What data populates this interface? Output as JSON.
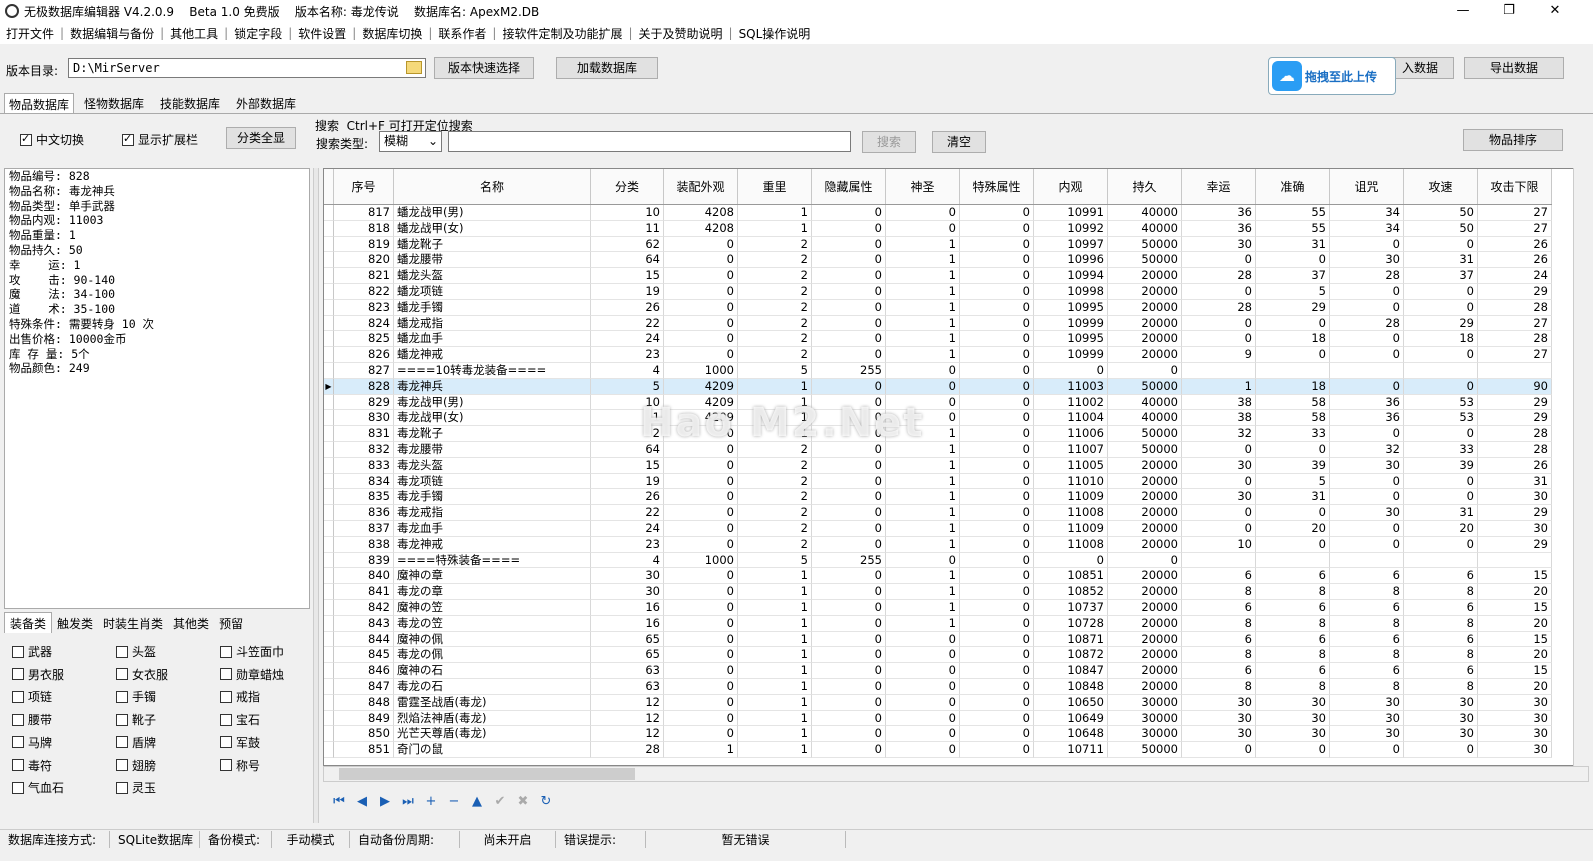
{
  "window": {
    "title": "无极数据库编辑器 V4.2.0.9    Beta 1.0 免费版    版本名称: 毒龙传说    数据库名: ApexM2.DB",
    "min": "—",
    "max": "❐",
    "close": "✕"
  },
  "menu": [
    "打开文件",
    "数据编辑与备份",
    "其他工具",
    "锁定字段",
    "软件设置",
    "数据库切换",
    "联系作者",
    "接软件定制及功能扩展",
    "关于及赞助说明",
    "SQL操作说明"
  ],
  "toolbar": {
    "dir_label": "版本目录:",
    "dir_value": "D:\\MirServer",
    "quick_select": "版本快速选择",
    "load_db": "加载数据库",
    "import_data": "入数据",
    "export_data": "导出数据",
    "upload_label": "拖拽至此上传"
  },
  "tabs": [
    "物品数据库",
    "怪物数据库",
    "技能数据库",
    "外部数据库"
  ],
  "options": {
    "cn_switch": "中文切换",
    "show_ext": "显示扩展栏",
    "show_all": "分类全显",
    "search_title": "搜索  Ctrl+F 可打开定位搜索",
    "search_type_label": "搜索类型:",
    "search_type_value": "模糊",
    "search_btn": "搜索",
    "clear_btn": "清空",
    "sort_btn": "物品排序"
  },
  "info": [
    "物品编号: 828",
    "物品名称: 毒龙神兵",
    "物品类型: 单手武器",
    "物品内观: 11003",
    "物品重量: 1",
    "物品持久: 50",
    "幸    运: 1",
    "攻    击: 90-140",
    "魔    法: 34-100",
    "道    术: 35-100",
    "特殊条件: 需要转身 10 次",
    "出售价格: 10000金币",
    "库 存 量: 5个",
    "物品颜色: 249"
  ],
  "grid": {
    "columns": [
      "序号",
      "名称",
      "分类",
      "装配外观",
      "重里",
      "隐藏属性",
      "神圣",
      "特殊属性",
      "内观",
      "持久",
      "幸运",
      "准确",
      "诅咒",
      "攻速",
      "攻击下限"
    ],
    "rows": [
      [
        "817",
        "蟠龙战甲(男)",
        "10",
        "4208",
        "1",
        "0",
        "0",
        "0",
        "10991",
        "40000",
        "36",
        "55",
        "34",
        "50",
        "27"
      ],
      [
        "818",
        "蟠龙战甲(女)",
        "11",
        "4208",
        "1",
        "0",
        "0",
        "0",
        "10992",
        "40000",
        "36",
        "55",
        "34",
        "50",
        "27"
      ],
      [
        "819",
        "蟠龙靴子",
        "62",
        "0",
        "2",
        "0",
        "1",
        "0",
        "10997",
        "50000",
        "30",
        "31",
        "0",
        "0",
        "26"
      ],
      [
        "820",
        "蟠龙腰带",
        "64",
        "0",
        "2",
        "0",
        "1",
        "0",
        "10996",
        "50000",
        "0",
        "0",
        "30",
        "31",
        "26"
      ],
      [
        "821",
        "蟠龙头盔",
        "15",
        "0",
        "2",
        "0",
        "1",
        "0",
        "10994",
        "20000",
        "28",
        "37",
        "28",
        "37",
        "24"
      ],
      [
        "822",
        "蟠龙项链",
        "19",
        "0",
        "2",
        "0",
        "1",
        "0",
        "10998",
        "20000",
        "0",
        "5",
        "0",
        "0",
        "29"
      ],
      [
        "823",
        "蟠龙手镯",
        "26",
        "0",
        "2",
        "0",
        "1",
        "0",
        "10995",
        "20000",
        "28",
        "29",
        "0",
        "0",
        "28"
      ],
      [
        "824",
        "蟠龙戒指",
        "22",
        "0",
        "2",
        "0",
        "1",
        "0",
        "10999",
        "20000",
        "0",
        "0",
        "28",
        "29",
        "27"
      ],
      [
        "825",
        "蟠龙血手",
        "24",
        "0",
        "2",
        "0",
        "1",
        "0",
        "10995",
        "20000",
        "0",
        "18",
        "0",
        "18",
        "28"
      ],
      [
        "826",
        "蟠龙神戒",
        "23",
        "0",
        "2",
        "0",
        "1",
        "0",
        "10999",
        "20000",
        "9",
        "0",
        "0",
        "0",
        "27"
      ],
      [
        "827",
        "====10转毒龙装备====",
        "4",
        "1000",
        "5",
        "255",
        "0",
        "0",
        "0",
        "0",
        "",
        "",
        "",
        "",
        ""
      ],
      [
        "828",
        "毒龙神兵",
        "5",
        "4209",
        "1",
        "0",
        "0",
        "0",
        "11003",
        "50000",
        "1",
        "18",
        "0",
        "0",
        "90"
      ],
      [
        "829",
        "毒龙战甲(男)",
        "10",
        "4209",
        "1",
        "0",
        "0",
        "0",
        "11002",
        "40000",
        "38",
        "58",
        "36",
        "53",
        "29"
      ],
      [
        "830",
        "毒龙战甲(女)",
        "1",
        "4209",
        "1",
        "0",
        "0",
        "0",
        "11004",
        "40000",
        "38",
        "58",
        "36",
        "53",
        "29"
      ],
      [
        "831",
        "毒龙靴子",
        "2",
        "0",
        "1",
        "0",
        "1",
        "0",
        "11006",
        "50000",
        "32",
        "33",
        "0",
        "0",
        "28"
      ],
      [
        "832",
        "毒龙腰带",
        "64",
        "0",
        "2",
        "0",
        "1",
        "0",
        "11007",
        "50000",
        "0",
        "0",
        "32",
        "33",
        "28"
      ],
      [
        "833",
        "毒龙头盔",
        "15",
        "0",
        "2",
        "0",
        "1",
        "0",
        "11005",
        "20000",
        "30",
        "39",
        "30",
        "39",
        "26"
      ],
      [
        "834",
        "毒龙项链",
        "19",
        "0",
        "2",
        "0",
        "1",
        "0",
        "11010",
        "20000",
        "0",
        "5",
        "0",
        "0",
        "31"
      ],
      [
        "835",
        "毒龙手镯",
        "26",
        "0",
        "2",
        "0",
        "1",
        "0",
        "11009",
        "20000",
        "30",
        "31",
        "0",
        "0",
        "30"
      ],
      [
        "836",
        "毒龙戒指",
        "22",
        "0",
        "2",
        "0",
        "1",
        "0",
        "11008",
        "20000",
        "0",
        "0",
        "30",
        "31",
        "29"
      ],
      [
        "837",
        "毒龙血手",
        "24",
        "0",
        "2",
        "0",
        "1",
        "0",
        "11009",
        "20000",
        "0",
        "20",
        "0",
        "20",
        "30"
      ],
      [
        "838",
        "毒龙神戒",
        "23",
        "0",
        "2",
        "0",
        "1",
        "0",
        "11008",
        "20000",
        "10",
        "0",
        "0",
        "0",
        "29"
      ],
      [
        "839",
        "====特殊装备====",
        "4",
        "1000",
        "5",
        "255",
        "0",
        "0",
        "0",
        "0",
        "",
        "",
        "",
        "",
        ""
      ],
      [
        "840",
        "魔神の章",
        "30",
        "0",
        "1",
        "0",
        "1",
        "0",
        "10851",
        "20000",
        "6",
        "6",
        "6",
        "6",
        "15"
      ],
      [
        "841",
        "毒龙の章",
        "30",
        "0",
        "1",
        "0",
        "1",
        "0",
        "10852",
        "20000",
        "8",
        "8",
        "8",
        "8",
        "20"
      ],
      [
        "842",
        "魔神の笠",
        "16",
        "0",
        "1",
        "0",
        "1",
        "0",
        "10737",
        "20000",
        "6",
        "6",
        "6",
        "6",
        "15"
      ],
      [
        "843",
        "毒龙の笠",
        "16",
        "0",
        "1",
        "0",
        "1",
        "0",
        "10728",
        "20000",
        "8",
        "8",
        "8",
        "8",
        "20"
      ],
      [
        "844",
        "魔神の佩",
        "65",
        "0",
        "1",
        "0",
        "0",
        "0",
        "10871",
        "20000",
        "6",
        "6",
        "6",
        "6",
        "15"
      ],
      [
        "845",
        "毒龙の佩",
        "65",
        "0",
        "1",
        "0",
        "0",
        "0",
        "10872",
        "20000",
        "8",
        "8",
        "8",
        "8",
        "20"
      ],
      [
        "846",
        "魔神の石",
        "63",
        "0",
        "1",
        "0",
        "0",
        "0",
        "10847",
        "20000",
        "6",
        "6",
        "6",
        "6",
        "15"
      ],
      [
        "847",
        "毒龙の石",
        "63",
        "0",
        "1",
        "0",
        "0",
        "0",
        "10848",
        "20000",
        "8",
        "8",
        "8",
        "8",
        "20"
      ],
      [
        "848",
        "雷霆圣战盾(毒龙)",
        "12",
        "0",
        "1",
        "0",
        "0",
        "0",
        "10650",
        "30000",
        "30",
        "30",
        "30",
        "30",
        "30"
      ],
      [
        "849",
        "烈焰法神盾(毒龙)",
        "12",
        "0",
        "1",
        "0",
        "0",
        "0",
        "10649",
        "30000",
        "30",
        "30",
        "30",
        "30",
        "30"
      ],
      [
        "850",
        "光芒天尊盾(毒龙)",
        "12",
        "0",
        "1",
        "0",
        "0",
        "0",
        "10648",
        "30000",
        "30",
        "30",
        "30",
        "30",
        "30"
      ],
      [
        "851",
        "奇门の鼠",
        "28",
        "1",
        "1",
        "0",
        "0",
        "0",
        "10711",
        "50000",
        "0",
        "0",
        "0",
        "0",
        "30"
      ]
    ],
    "selected_row": "828"
  },
  "categories": {
    "tabs": [
      "装备类",
      "触发类",
      "时装生肖类",
      "其他类",
      "预留"
    ],
    "items": [
      "武器",
      "头盔",
      "斗笠面巾",
      "男衣服",
      "女衣服",
      "勋章蜡烛",
      "项链",
      "手镯",
      "戒指",
      "腰带",
      "靴子",
      "宝石",
      "马牌",
      "盾牌",
      "军鼓",
      "毒符",
      "翅膀",
      "称号",
      "气血石",
      "灵玉"
    ]
  },
  "nav": [
    "first-icon",
    "prev-icon",
    "next-icon",
    "last-icon",
    "add-icon",
    "delete-icon",
    "edit-icon",
    "confirm-icon",
    "cancel-icon",
    "refresh-icon"
  ],
  "status": [
    "数据库连接方式:",
    "SQLite数据库",
    "备份模式:",
    "手动模式",
    "自动备份周期:",
    "尚未开启",
    "错误提示:",
    "暂无错误"
  ],
  "watermark": "Hao M2.Net"
}
